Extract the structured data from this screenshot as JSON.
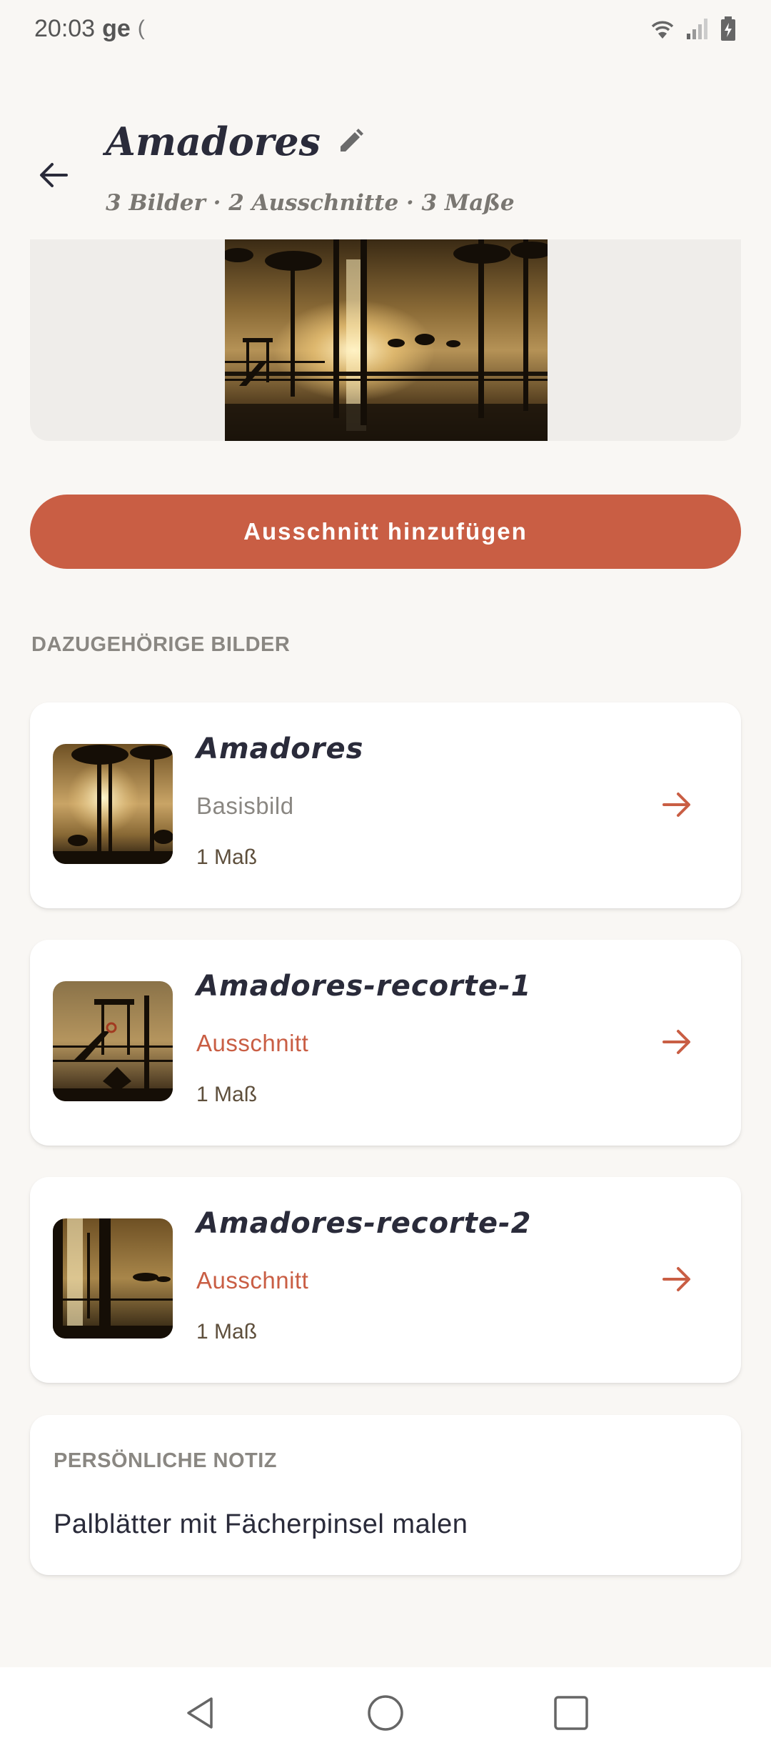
{
  "status_bar": {
    "time": "20:03",
    "carrier": "ge",
    "sim_glyph": "("
  },
  "header": {
    "title": "Amadores",
    "subtitle": "3 Bilder · 2 Ausschnitte · 3 Maße"
  },
  "actions": {
    "add_crop_label": "Ausschnitt hinzufügen"
  },
  "related": {
    "section_label": "DAZUGEHÖRIGE BILDER",
    "items": [
      {
        "name": "Amadores",
        "kind": "Basisbild",
        "count": "1 Maß"
      },
      {
        "name": "Amadores-recorte-1",
        "kind": "Ausschnitt",
        "count": "1 Maß"
      },
      {
        "name": "Amadores-recorte-2",
        "kind": "Ausschnitt",
        "count": "1 Maß"
      }
    ]
  },
  "note": {
    "label": "PERSÖNLICHE NOTIZ",
    "text": "Palblätter mit Fächerpinsel malen"
  },
  "icons": {
    "back": "arrow-left-icon",
    "edit": "pencil-icon",
    "open": "arrow-right-icon",
    "nav_back": "triangle-back-icon",
    "nav_home": "circle-home-icon",
    "nav_recents": "square-recents-icon"
  },
  "colors": {
    "accent": "#c95e44",
    "background": "#f9f7f4",
    "text": "#2a2b3a",
    "muted": "#8a8782"
  }
}
